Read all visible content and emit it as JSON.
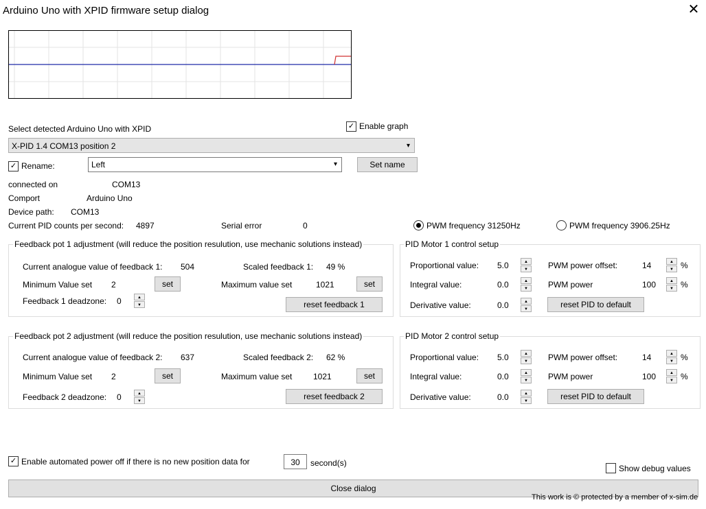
{
  "window": {
    "title": "Arduino Uno with XPID firmware setup dialog",
    "close_glyph": "✕"
  },
  "graph": {
    "enabled": true,
    "enable_label": "Enable graph"
  },
  "device": {
    "select_label": "Select detected Arduino Uno with XPID",
    "selected": "X-PID 1.4 COM13 position 2",
    "rename_label": "Rename:",
    "rename_checked": true,
    "name_value": "Left",
    "set_name_label": "Set name",
    "connected_on_label": "connected on",
    "connected_on_value": "COM13",
    "comport_label": "Comport",
    "comport_value": "Arduino Uno",
    "device_path_label": "Device path:",
    "device_path_value": "COM13",
    "pid_counts_label": "Current PID counts per second:",
    "pid_counts_value": "4897",
    "serial_error_label": "Serial error",
    "serial_error_value": "0"
  },
  "pwm": {
    "opt1": "PWM frequency 31250Hz",
    "opt2": "PWM frequency 3906.25Hz",
    "selected": "opt1"
  },
  "feedback1": {
    "title": "Feedback pot 1 adjustment (will reduce the position resulution, use mechanic solutions instead)",
    "current_label": "Current analogue value of feedback 1:",
    "current_value": "504",
    "scaled_label": "Scaled feedback 1:",
    "scaled_value": "49 %",
    "min_label": "Minimum Value set",
    "min_value": "2",
    "max_label": "Maximum value set",
    "max_value": "1021",
    "set_label": "set",
    "deadzone_label": "Feedback 1 deadzone:",
    "deadzone_value": "0",
    "reset_label": "reset feedback 1"
  },
  "feedback2": {
    "title": "Feedback pot 2 adjustment (will reduce the position resulution, use mechanic solutions instead)",
    "current_label": "Current analogue value of feedback 2:",
    "current_value": "637",
    "scaled_label": "Scaled feedback 2:",
    "scaled_value": "62 %",
    "min_label": "Minimum Value set",
    "min_value": "2",
    "max_label": "Maximum value set",
    "max_value": "1021",
    "set_label": "set",
    "deadzone_label": "Feedback 2 deadzone:",
    "deadzone_value": "0",
    "reset_label": "reset feedback 2"
  },
  "pid1": {
    "title": "PID Motor 1 control setup",
    "p_label": "Proportional value:",
    "p_value": "5.0",
    "i_label": "Integral value:",
    "i_value": "0.0",
    "d_label": "Derivative value:",
    "d_value": "0.0",
    "offset_label": "PWM power offset:",
    "offset_value": "14",
    "power_label": "PWM power",
    "power_value": "100",
    "unit": "%",
    "reset_label": "reset PID to default"
  },
  "pid2": {
    "title": "PID Motor 2 control setup",
    "p_label": "Proportional value:",
    "p_value": "5.0",
    "i_label": "Integral value:",
    "i_value": "0.0",
    "d_label": "Derivative value:",
    "d_value": "0.0",
    "offset_label": "PWM power offset:",
    "offset_value": "14",
    "power_label": "PWM power",
    "power_value": "100",
    "unit": "%",
    "reset_label": "reset PID to default"
  },
  "footer": {
    "poweroff_label": "Enable automated power off if there is no new position data for",
    "poweroff_checked": true,
    "seconds_value": "30",
    "seconds_label": "second(s)",
    "debug_label": "Show debug values",
    "close_label": "Close dialog",
    "copyright": "This work is © protected by a member of x-sim.de"
  },
  "colors": {
    "graph_blue": "#1f2aa6",
    "graph_red": "#d03030",
    "button_bg": "#e1e1e1"
  }
}
